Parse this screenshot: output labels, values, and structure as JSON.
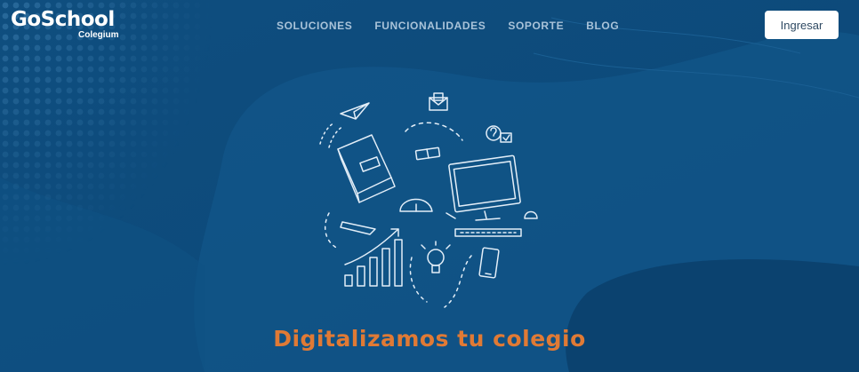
{
  "brand": {
    "name": "GoSchool",
    "sub": "Colegium"
  },
  "nav": {
    "items": [
      {
        "label": "SOLUCIONES"
      },
      {
        "label": "FUNCIONALIDADES"
      },
      {
        "label": "SOPORTE"
      },
      {
        "label": "BLOG"
      }
    ],
    "login_label": "Ingresar"
  },
  "hero": {
    "headline": "Digitalizamos tu colegio",
    "illustration_icons": [
      "paper-plane-icon",
      "envelope-icon",
      "book-icon",
      "eraser-icon",
      "chat-question-icon",
      "monitor-icon",
      "protractor-icon",
      "pencil-icon",
      "bar-chart-icon",
      "lightbulb-icon",
      "smartphone-icon"
    ]
  },
  "colors": {
    "background": "#0d4f80",
    "accent": "#e07a35",
    "nav_text": "#a9c3d9",
    "button_bg": "#ffffff"
  }
}
